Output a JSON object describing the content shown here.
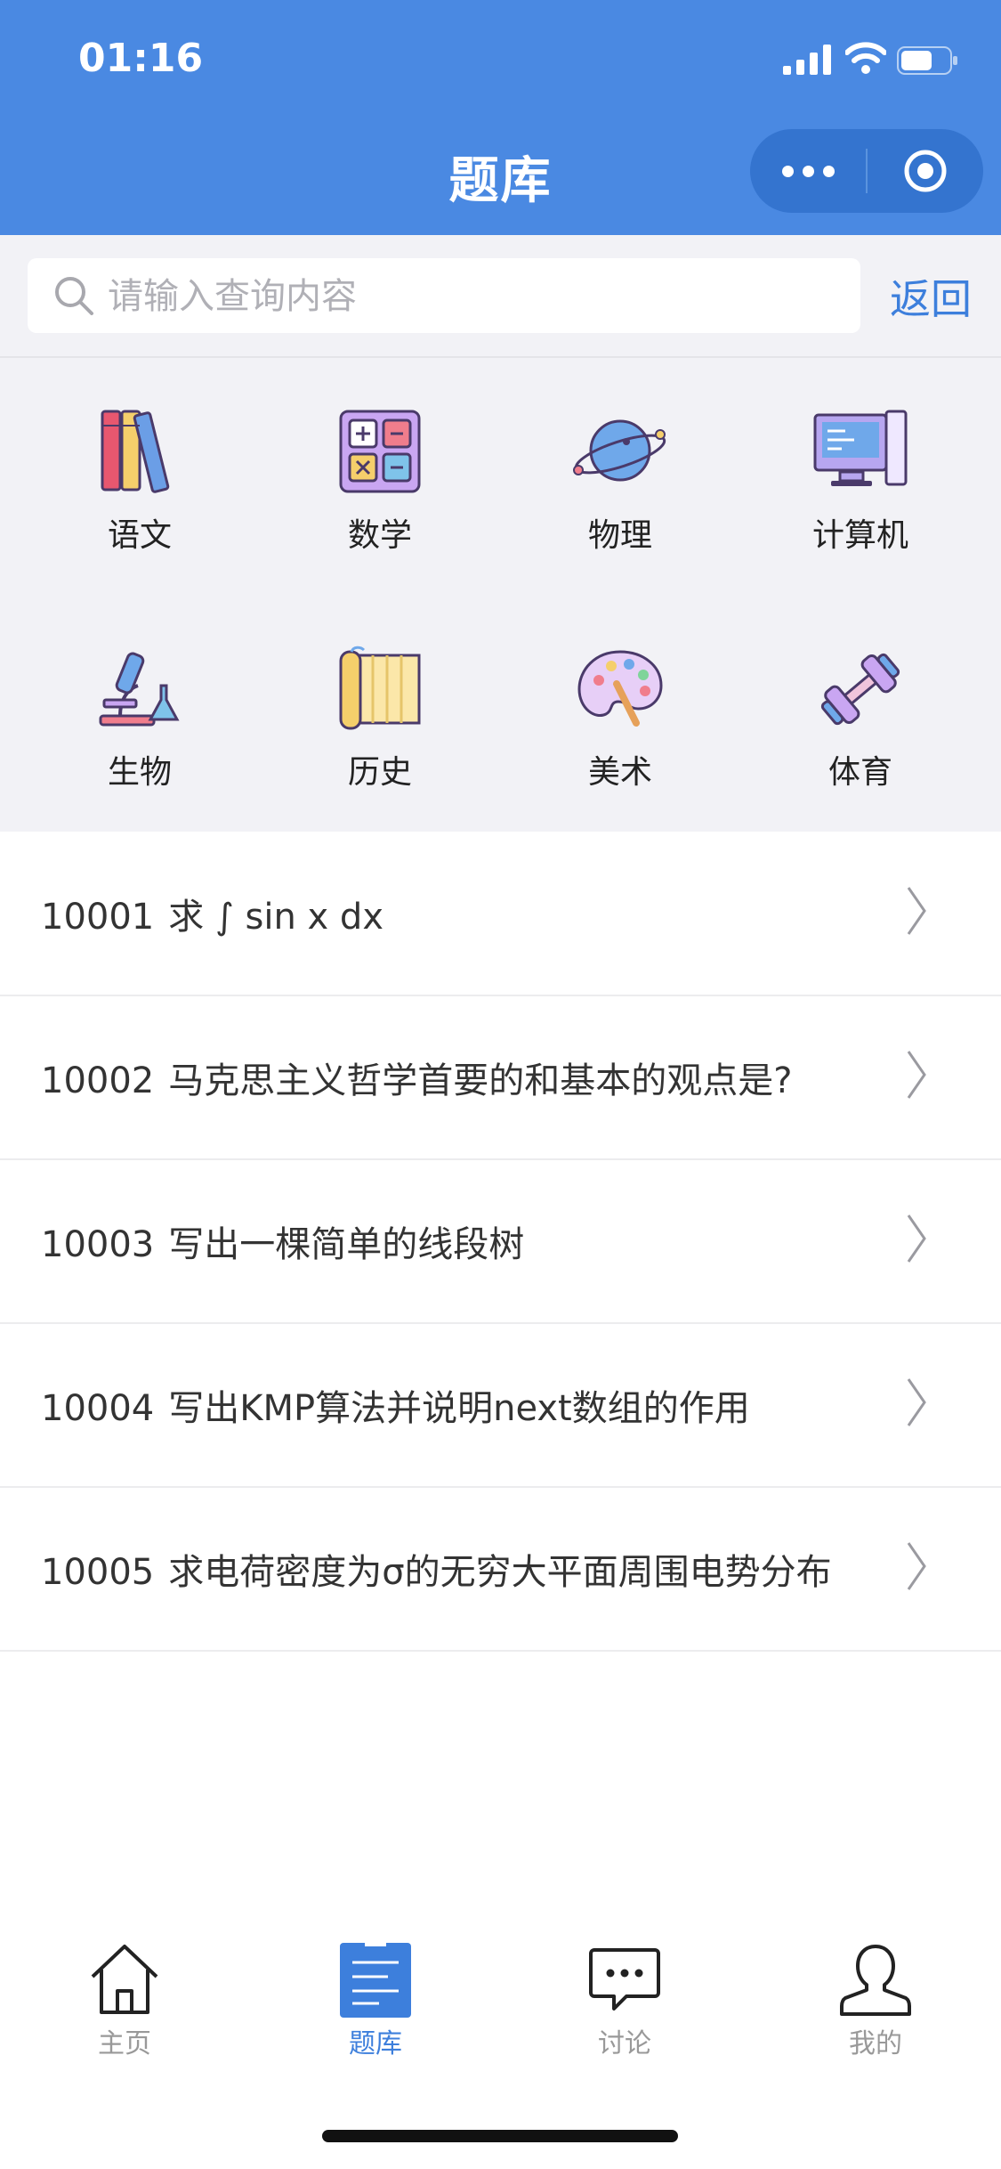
{
  "status_bar": {
    "time": "01:16"
  },
  "header": {
    "title": "题库"
  },
  "search": {
    "placeholder": "请输入查询内容",
    "back_label": "返回"
  },
  "categories": [
    {
      "label": "语文",
      "icon": "books-icon"
    },
    {
      "label": "数学",
      "icon": "calculator-icon"
    },
    {
      "label": "物理",
      "icon": "planet-icon"
    },
    {
      "label": "计算机",
      "icon": "computer-icon"
    },
    {
      "label": "生物",
      "icon": "microscope-icon"
    },
    {
      "label": "历史",
      "icon": "scroll-icon"
    },
    {
      "label": "美术",
      "icon": "palette-icon"
    },
    {
      "label": "体育",
      "icon": "dumbbell-icon"
    }
  ],
  "questions": [
    {
      "id": "10001",
      "text": "求 ∫ sin x dx"
    },
    {
      "id": "10002",
      "text": "马克思主义哲学首要的和基本的观点是?"
    },
    {
      "id": "10003",
      "text": "写出一棵简单的线段树"
    },
    {
      "id": "10004",
      "text": "写出KMP算法并说明next数组的作用"
    },
    {
      "id": "10005",
      "text": "求电荷密度为σ的无穷大平面周围电势分布"
    }
  ],
  "tabbar": {
    "items": [
      {
        "label": "主页",
        "icon": "home-icon",
        "active": false
      },
      {
        "label": "题库",
        "icon": "question-bank-icon",
        "active": true
      },
      {
        "label": "讨论",
        "icon": "chat-icon",
        "active": false
      },
      {
        "label": "我的",
        "icon": "user-icon",
        "active": false
      }
    ]
  },
  "colors": {
    "primary": "#4a89e2",
    "accent": "#3d7fdc",
    "background": "#f2f2f6"
  }
}
